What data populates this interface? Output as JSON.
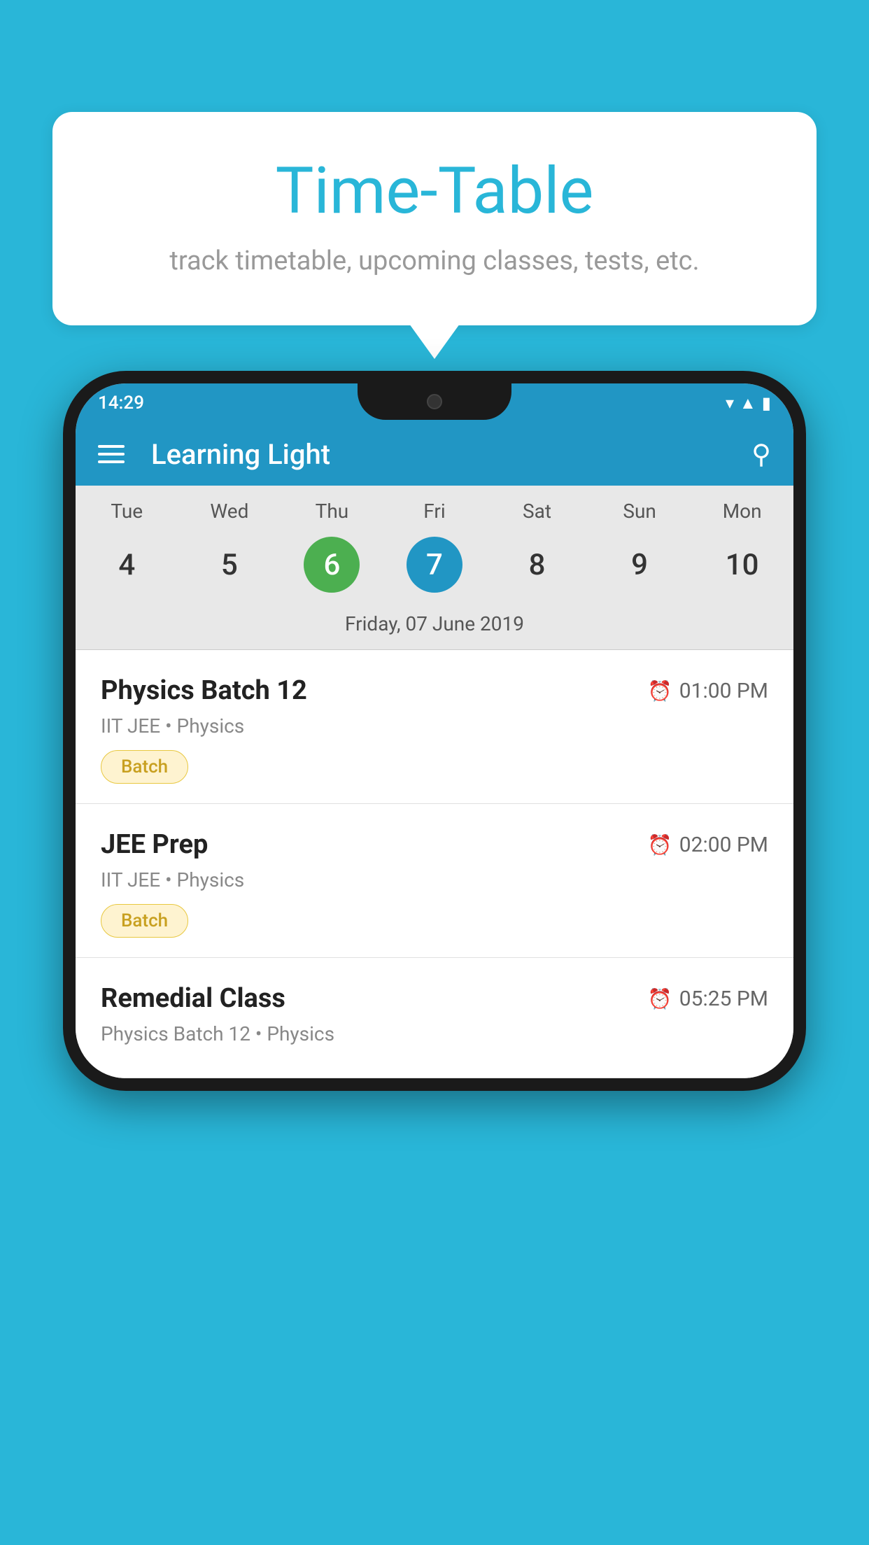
{
  "background": {
    "color": "#29b6d8"
  },
  "speech_bubble": {
    "title": "Time-Table",
    "subtitle": "track timetable, upcoming classes, tests, etc."
  },
  "phone": {
    "status_bar": {
      "time": "14:29"
    },
    "app_bar": {
      "title": "Learning Light"
    },
    "calendar": {
      "days": [
        "Tue",
        "Wed",
        "Thu",
        "Fri",
        "Sat",
        "Sun",
        "Mon"
      ],
      "dates": [
        "4",
        "5",
        "6",
        "7",
        "8",
        "9",
        "10"
      ],
      "today_index": 2,
      "selected_index": 3,
      "selected_label": "Friday, 07 June 2019"
    },
    "classes": [
      {
        "name": "Physics Batch 12",
        "time": "01:00 PM",
        "subtitle": "IIT JEE • Physics",
        "badge": "Batch"
      },
      {
        "name": "JEE Prep",
        "time": "02:00 PM",
        "subtitle": "IIT JEE • Physics",
        "badge": "Batch"
      },
      {
        "name": "Remedial Class",
        "time": "05:25 PM",
        "subtitle": "Physics Batch 12 • Physics",
        "badge": ""
      }
    ]
  }
}
